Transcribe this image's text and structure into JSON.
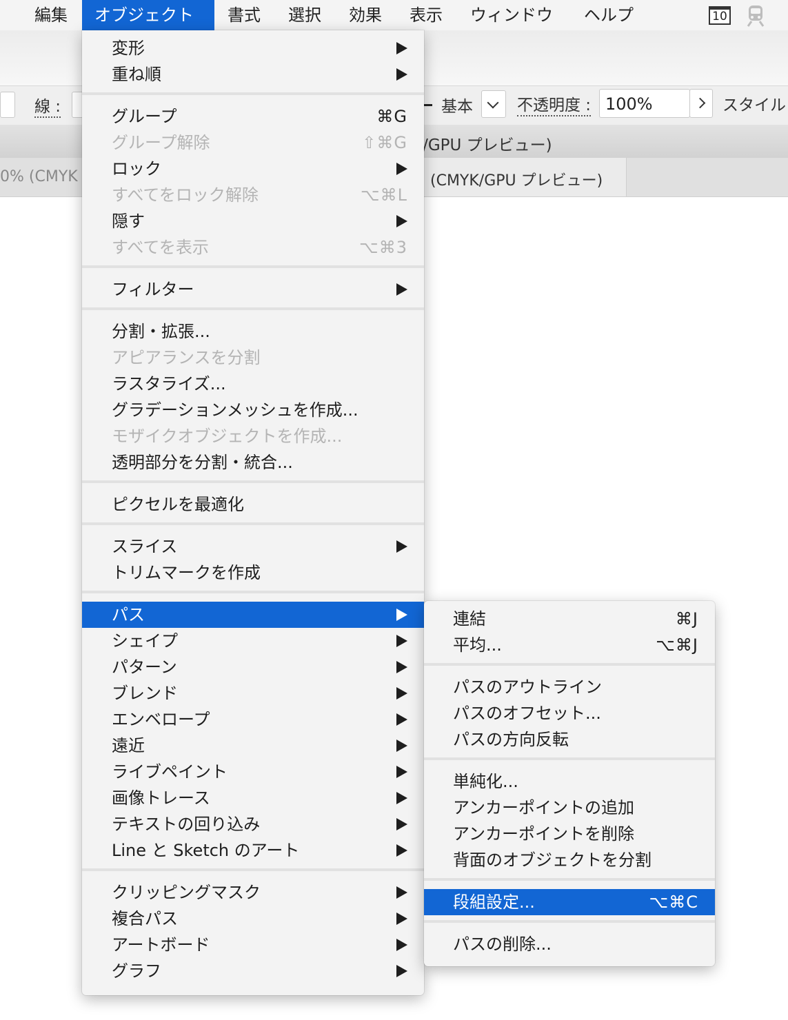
{
  "menubar": {
    "items": [
      {
        "label": "編集"
      },
      {
        "label": "オブジェクト",
        "active": true
      },
      {
        "label": "書式"
      },
      {
        "label": "選択"
      },
      {
        "label": "効果"
      },
      {
        "label": "表示"
      },
      {
        "label": "ウィンドウ"
      },
      {
        "label": "ヘルプ"
      }
    ],
    "calendar_icon_text": "10",
    "accent_color": "#1266d4"
  },
  "background": {
    "stroke_label": "線 :",
    "brush_label": "基本",
    "opacity_label": "不透明度 :",
    "opacity_value": "100%",
    "style_label": "スタイル",
    "title_text": "K/GPU プレビュー)",
    "tab_left_text": "0% (CMYK",
    "tab_right_text": "(CMYK/GPU プレビュー)"
  },
  "main_menu": {
    "groups": [
      [
        {
          "label": "変形",
          "submenu": true
        },
        {
          "label": "重ね順",
          "submenu": true
        }
      ],
      [
        {
          "label": "グループ",
          "shortcut": "⌘G"
        },
        {
          "label": "グループ解除",
          "shortcut": "⇧⌘G",
          "disabled": true
        },
        {
          "label": "ロック",
          "submenu": true
        },
        {
          "label": "すべてをロック解除",
          "shortcut": "⌥⌘L",
          "disabled": true
        },
        {
          "label": "隠す",
          "submenu": true
        },
        {
          "label": "すべてを表示",
          "shortcut": "⌥⌘3",
          "disabled": true
        }
      ],
      [
        {
          "label": "フィルター",
          "submenu": true
        }
      ],
      [
        {
          "label": "分割・拡張..."
        },
        {
          "label": "アピアランスを分割",
          "disabled": true
        },
        {
          "label": "ラスタライズ..."
        },
        {
          "label": "グラデーションメッシュを作成..."
        },
        {
          "label": "モザイクオブジェクトを作成...",
          "disabled": true
        },
        {
          "label": "透明部分を分割・統合..."
        }
      ],
      [
        {
          "label": "ピクセルを最適化"
        }
      ],
      [
        {
          "label": "スライス",
          "submenu": true
        },
        {
          "label": "トリムマークを作成"
        }
      ],
      [
        {
          "label": "パス",
          "submenu": true,
          "highlight": true
        },
        {
          "label": "シェイプ",
          "submenu": true
        },
        {
          "label": "パターン",
          "submenu": true
        },
        {
          "label": "ブレンド",
          "submenu": true
        },
        {
          "label": "エンベロープ",
          "submenu": true
        },
        {
          "label": "遠近",
          "submenu": true
        },
        {
          "label": "ライブペイント",
          "submenu": true
        },
        {
          "label": "画像トレース",
          "submenu": true
        },
        {
          "label": "テキストの回り込み",
          "submenu": true
        },
        {
          "label": "Line と Sketch のアート",
          "submenu": true
        }
      ],
      [
        {
          "label": "クリッピングマスク",
          "submenu": true
        },
        {
          "label": "複合パス",
          "submenu": true
        },
        {
          "label": "アートボード",
          "submenu": true
        },
        {
          "label": "グラフ",
          "submenu": true
        }
      ]
    ]
  },
  "path_submenu": {
    "groups": [
      [
        {
          "label": "連結",
          "shortcut": "⌘J"
        },
        {
          "label": "平均...",
          "shortcut": "⌥⌘J"
        }
      ],
      [
        {
          "label": "パスのアウトライン"
        },
        {
          "label": "パスのオフセット..."
        },
        {
          "label": "パスの方向反転"
        }
      ],
      [
        {
          "label": "単純化..."
        },
        {
          "label": "アンカーポイントの追加"
        },
        {
          "label": "アンカーポイントを削除"
        },
        {
          "label": "背面のオブジェクトを分割"
        }
      ],
      [
        {
          "label": "段組設定...",
          "shortcut": "⌥⌘C",
          "highlight": true
        }
      ],
      [
        {
          "label": "パスの削除..."
        }
      ]
    ]
  }
}
